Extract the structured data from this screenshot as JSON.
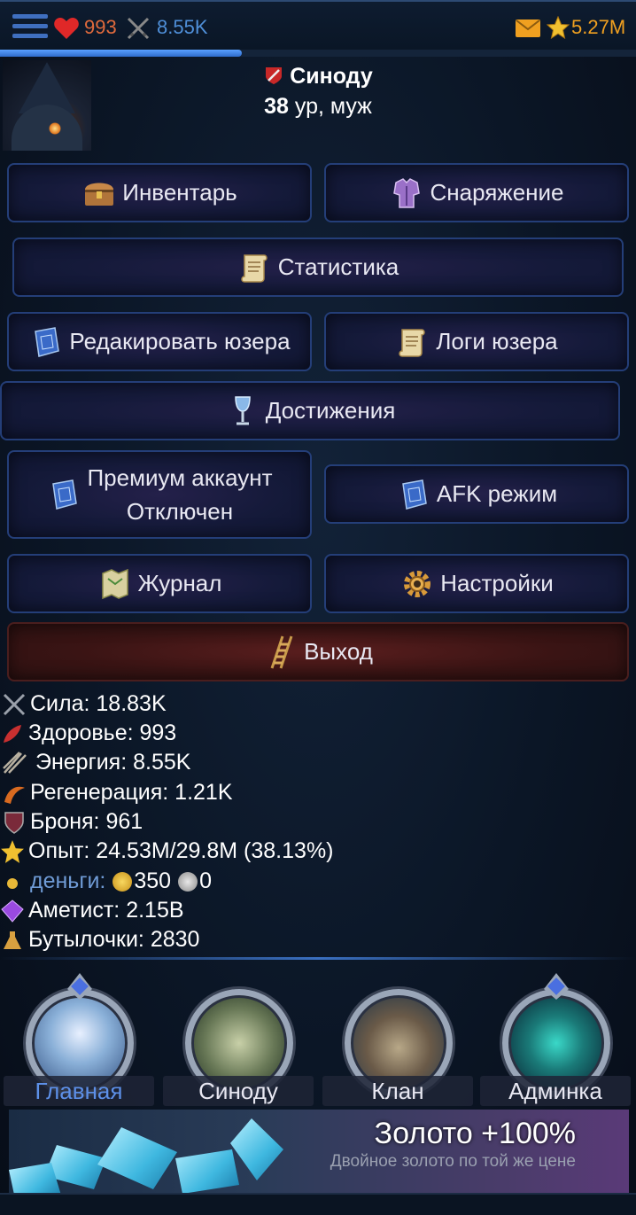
{
  "topbar": {
    "hp": "993",
    "energy": "8.55K",
    "gold": "5.27M",
    "colors": {
      "hp": "#e06a3c",
      "energy": "#4f8fd8",
      "gold": "#f0a020"
    },
    "progress_fraction": 0.38
  },
  "profile": {
    "name": "Синоду",
    "level": "38",
    "level_suffix": " ур, муж"
  },
  "menu": {
    "inventory": "Инвентарь",
    "equipment": "Снаряжение",
    "statistics": "Статистика",
    "edit_user": "Редакировать юзера",
    "user_logs": "Логи юзера",
    "achievements": "Достижения",
    "premium": "Премиум аккаунт",
    "premium_status": "Отключен",
    "afk": "AFK режим",
    "journal": "Журнал",
    "settings": "Настройки",
    "exit": "Выход"
  },
  "stats": {
    "strength": "Сила: 18.83K",
    "health": "Здоровье: 993",
    "energy": "Энергия: 8.55K",
    "regeneration": "Регенерация: 1.21K",
    "armor": "Броня: 961",
    "experience": "Опыт: 24.53M/29.8M (38.13%)",
    "money_label": "деньги:",
    "money_gold": "350",
    "money_silver": "0",
    "amethyst": "Аметист: 2.15B",
    "bottles": "Бутылочки: 2830"
  },
  "nav": {
    "main": "Главная",
    "profile": "Синоду",
    "clan": "Клан",
    "admin": "Админка",
    "active": "main"
  },
  "promo": {
    "title": "Золото +100%",
    "subtitle": "Двойное золото по той же цене"
  },
  "icons": [
    "menu-icon",
    "heart-icon",
    "crossed-swords-icon",
    "mail-icon",
    "star-icon",
    "chest-icon",
    "armor-icon",
    "scroll-icon",
    "spellbook-icon",
    "goblet-icon",
    "map-icon",
    "gear-icon",
    "ladder-icon",
    "feather-icon",
    "shield-icon",
    "gold-coin-icon",
    "silver-coin-icon",
    "amethyst-icon",
    "potion-icon"
  ]
}
